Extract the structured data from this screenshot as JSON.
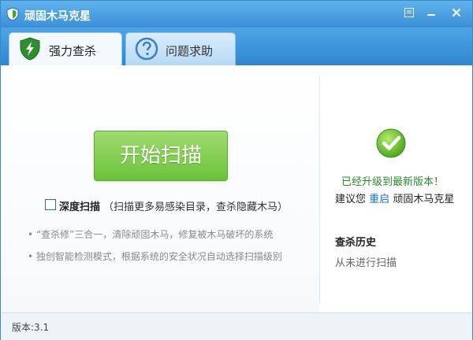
{
  "window": {
    "title": "顽固木马克星"
  },
  "tabs": [
    {
      "label": "强力查杀",
      "icon": "shield-lightning-icon",
      "active": true
    },
    {
      "label": "问题求助",
      "icon": "question-icon",
      "active": false
    }
  ],
  "scan": {
    "start_label": "开始扫描",
    "deep_scan": {
      "label": "深度扫描",
      "desc": "（扫描更多易感染目录，查杀隐藏木马）",
      "checked": false
    },
    "features": [
      "“查杀修”三合一，清除顽固木马，修复被木马破坏的系统",
      "独创智能检测模式，根据系统的安全状况自动选择扫描级别"
    ]
  },
  "status_panel": {
    "upgraded": "已经升级到最新版本！",
    "suggest_prefix": "建议您",
    "suggest_link": "重启",
    "suggest_suffix": "顽固木马克星",
    "history_title": "查杀历史",
    "history_text": "从未进行扫描"
  },
  "footer": {
    "version": "版本:3.1"
  },
  "colors": {
    "titlebar": "#3b8fd6",
    "accent_green": "#6cc23b",
    "link_blue": "#1a6ed8"
  }
}
